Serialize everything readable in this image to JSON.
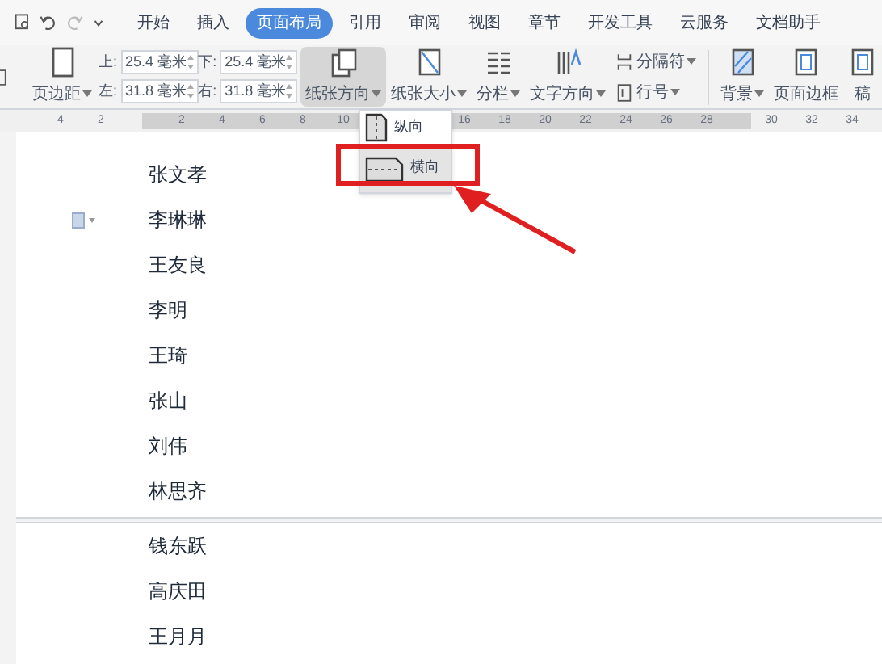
{
  "menu_tabs": [
    {
      "label": "开始",
      "selected": false
    },
    {
      "label": "插入",
      "selected": false
    },
    {
      "label": "页面布局",
      "selected": true
    },
    {
      "label": "引用",
      "selected": false
    },
    {
      "label": "审阅",
      "selected": false
    },
    {
      "label": "视图",
      "selected": false
    },
    {
      "label": "章节",
      "selected": false
    },
    {
      "label": "开发工具",
      "selected": false
    },
    {
      "label": "云服务",
      "selected": false
    },
    {
      "label": "文档助手",
      "selected": false
    }
  ],
  "ribbon": {
    "margins_button": "页边距",
    "margins": [
      {
        "label": "上:",
        "value": "25.4 毫米"
      },
      {
        "label": "下:",
        "value": "25.4 毫米"
      },
      {
        "label": "左:",
        "value": "31.8 毫米"
      },
      {
        "label": "右:",
        "value": "31.8 毫米"
      }
    ],
    "orientation_button": {
      "label": "纸张方向",
      "selected": true
    },
    "tools": [
      {
        "label": "纸张大小",
        "caret": true
      },
      {
        "label": "分栏",
        "caret": true
      },
      {
        "label": "文字方向",
        "caret": true
      }
    ],
    "small_tools": [
      {
        "label": "分隔符",
        "caret": true
      },
      {
        "label": "行号",
        "caret": true
      }
    ],
    "tools2": [
      {
        "label": "背景",
        "caret": true
      },
      {
        "label": "页面边框",
        "caret": false
      },
      {
        "label": "稿",
        "caret": false
      }
    ]
  },
  "ruler": {
    "left_ticks": [
      "4",
      "2"
    ],
    "ticks": [
      "2",
      "4",
      "6",
      "8",
      "10",
      "16",
      "18",
      "20",
      "22",
      "24",
      "26",
      "28"
    ],
    "right_ticks": [
      "30",
      "32",
      "34"
    ]
  },
  "orientation_menu": [
    {
      "label": "纵向",
      "kind": "portrait",
      "selected": false
    },
    {
      "label": "横向",
      "kind": "landscape",
      "selected": true
    }
  ],
  "page1_names": [
    "张文孝",
    "李琳琳",
    "王友良",
    "李明",
    "王琦",
    "张山",
    "刘伟",
    "林思齐"
  ],
  "page2_names": [
    "钱东跃",
    "高庆田",
    "王月月"
  ]
}
